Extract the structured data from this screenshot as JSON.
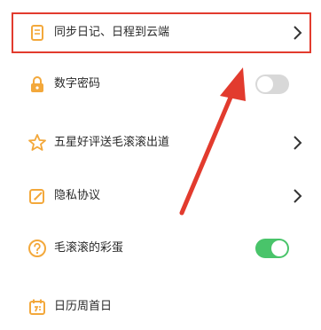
{
  "settings": {
    "items": [
      {
        "label": "同步日记、日程到云端",
        "icon": "document-icon",
        "control": "chevron"
      },
      {
        "label": "数字密码",
        "icon": "lock-icon",
        "control": "toggle",
        "toggle_on": false
      },
      {
        "label": "五星好评送毛滚滚出道",
        "icon": "star-icon",
        "control": "chevron"
      },
      {
        "label": "隐私协议",
        "icon": "edit-note-icon",
        "control": "chevron"
      },
      {
        "label": "毛滚滚的彩蛋",
        "icon": "question-icon",
        "control": "toggle",
        "toggle_on": true
      },
      {
        "label": "日历周首日",
        "icon": "calendar-icon",
        "control": "none"
      }
    ]
  },
  "colors": {
    "icon_orange": "#f3a83b",
    "highlight_red": "#e23b2e",
    "toggle_on": "#49c46a",
    "toggle_off": "#d8d8d8",
    "text": "#2a2a2a"
  },
  "annotation": {
    "highlight_target": "sync-cloud-item",
    "arrow_icon": "red-arrow-icon"
  }
}
